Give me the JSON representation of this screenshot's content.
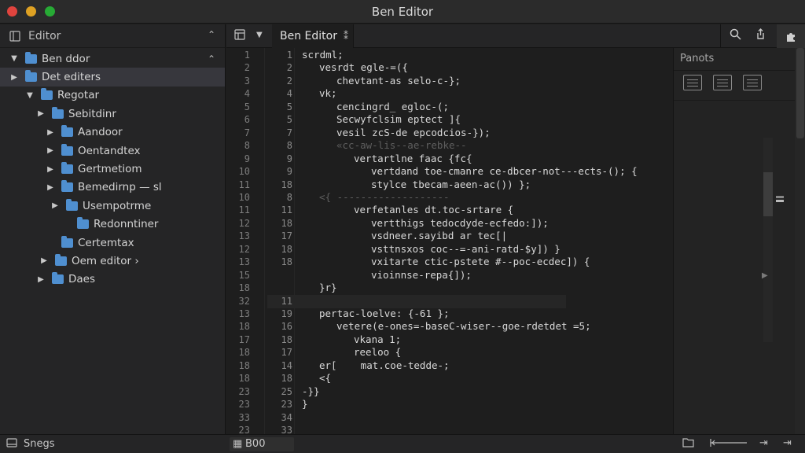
{
  "window": {
    "title": "Ben Editor"
  },
  "sidebar": {
    "title": "Editor",
    "items": [
      {
        "label": "Ben ddor",
        "arrow": "▼",
        "expanded": true
      },
      {
        "label": "Det editers",
        "arrow": "▶",
        "selected": true
      },
      {
        "label": "Regotar",
        "arrow": "▼",
        "expanded": true
      },
      {
        "label": "Sebitdinr",
        "arrow": "▶"
      },
      {
        "label": "Aandoor",
        "arrow": "▶"
      },
      {
        "label": "Oentandtex",
        "arrow": "▶"
      },
      {
        "label": "Gertmetiom",
        "arrow": "▶"
      },
      {
        "label": "Bemedirnp — sl",
        "arrow": "▶"
      },
      {
        "label": "Usempotrme",
        "arrow": "▶"
      },
      {
        "label": "Redonntiner",
        "arrow": ""
      },
      {
        "label": "Certemtax",
        "arrow": ""
      },
      {
        "label": "Oem editor ›",
        "arrow": "▶"
      },
      {
        "label": "Daes",
        "arrow": "▶"
      }
    ]
  },
  "tabbar": {
    "active_tab": "Ben Editor",
    "tab_close": "⁑"
  },
  "editor": {
    "lines": [
      {
        "n1": "1",
        "n2": "1",
        "code": "scrdml;",
        "indent": 0
      },
      {
        "n1": "2",
        "n2": "2",
        "code": "vesrdt egle-=({",
        "indent": 1
      },
      {
        "n1": "3",
        "n2": "2",
        "code": "chevtant-as selo-c-};",
        "indent": 2
      },
      {
        "n1": "4",
        "n2": "4",
        "code": "vk;",
        "indent": 1
      },
      {
        "n1": "5",
        "n2": "5",
        "code": "cencingrd_ egloc-(;",
        "indent": 2
      },
      {
        "n1": "6",
        "n2": "5",
        "code": "Secwyfclsim eptect ]{",
        "indent": 2
      },
      {
        "n1": "7",
        "n2": "7",
        "code": "vesil zcS-de epcodcios-});",
        "indent": 2
      },
      {
        "n1": "8",
        "n2": "8",
        "code": "«cc-aw-lis--ae-rebke--",
        "indent": 2,
        "dim": true
      },
      {
        "n1": "9",
        "n2": "9",
        "code": "vertartlne faac {fc{",
        "indent": 3
      },
      {
        "n1": "10",
        "n2": "9",
        "code": "vertdand toe-cmanre ce-dbcer-not---ects-(); {",
        "indent": 4
      },
      {
        "n1": "11",
        "n2": "18",
        "code": "stylce tbecam-aeen-ac()) };",
        "indent": 4
      },
      {
        "n1": "10",
        "n2": "8",
        "code": "<{ -------------------",
        "indent": 1,
        "dim": true
      },
      {
        "n1": "11",
        "n2": "11",
        "code": "verfetanles dt.toc-srtare {",
        "indent": 3
      },
      {
        "n1": "12",
        "n2": "18",
        "code": "vertthigs tedocdyde-ecfedo:]);",
        "indent": 4
      },
      {
        "n1": "13",
        "n2": "17",
        "code": "vsdneer.sayibd ar tec[|",
        "indent": 4
      },
      {
        "n1": "12",
        "n2": "18",
        "code": "vsttnsxos coc--=-ani-ratd-$y]) }",
        "indent": 4
      },
      {
        "n1": "13",
        "n2": "18",
        "code": "vxitarte ctic-pstete #--poc-ecdec]) {",
        "indent": 4
      },
      {
        "n1": "15",
        "n2": "",
        "code": "vioinnse-repa{]);",
        "indent": 4
      },
      {
        "n1": "18",
        "n2": "",
        "code": "}r}",
        "indent": 1
      },
      {
        "n1": "32",
        "n2": "11",
        "code": "",
        "indent": 0,
        "highlight": true
      },
      {
        "n1": "13",
        "n2": "19",
        "code": "pertac-loelve: {-61 };",
        "indent": 1
      },
      {
        "n1": "18",
        "n2": "16",
        "code": "vetere(e-ones=-baseC-wiser--goe-rdetdet =5;",
        "indent": 2
      },
      {
        "n1": "17",
        "n2": "18",
        "code": "vkana 1;",
        "indent": 3
      },
      {
        "n1": "18",
        "n2": "17",
        "code": "reeloo {",
        "indent": 3
      },
      {
        "n1": "18",
        "n2": "14",
        "code": "er[    mat.coe-tedde-;",
        "indent": 1
      },
      {
        "n1": "18",
        "n2": "18",
        "code": "<{",
        "indent": 1
      },
      {
        "n1": "23",
        "n2": "25",
        "code": "-}}",
        "indent": 0
      },
      {
        "n1": "23",
        "n2": "23",
        "code": "}",
        "indent": 0
      },
      {
        "n1": "33",
        "n2": "34",
        "code": "",
        "indent": 0
      },
      {
        "n1": "23",
        "n2": "33",
        "code": "",
        "indent": 0
      }
    ]
  },
  "panel": {
    "title": "Panots",
    "icons": [
      "list-icon",
      "grid-icon",
      "terminal-icon"
    ]
  },
  "status": {
    "left_text": "Snegs",
    "mid_text": "B00"
  },
  "colors": {
    "bg": "#1e1e1e",
    "sidebar": "#252526",
    "folder": "#4f8fd0",
    "traffic_red": "#e0443e",
    "traffic_yellow": "#dea123",
    "traffic_green": "#27aa35"
  }
}
